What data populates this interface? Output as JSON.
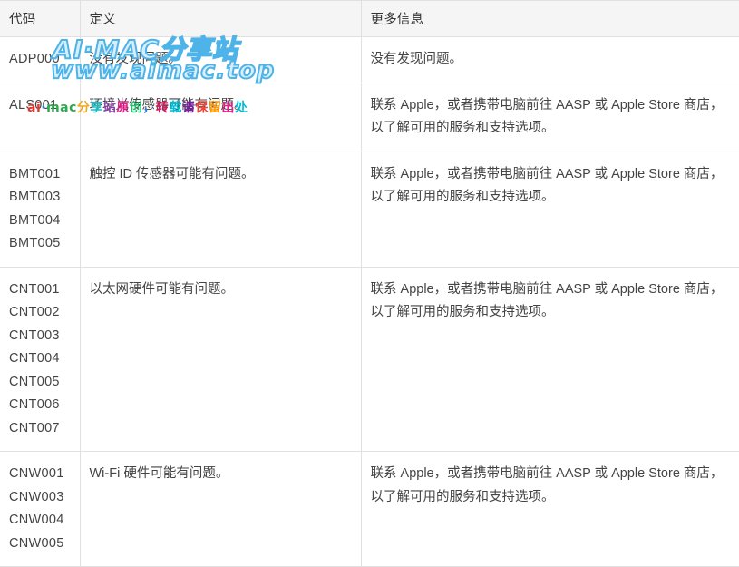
{
  "table": {
    "headers": [
      {
        "label": "代码"
      },
      {
        "label": "定义"
      },
      {
        "label": "更多信息"
      }
    ],
    "rows": [
      {
        "code": "ADP000",
        "definition": "没有发现问题。",
        "more_info": "没有发现问题。"
      },
      {
        "code": "ALS001",
        "definition": "环境光传感器可能有问题。",
        "more_info": "联系 Apple，或者携带电脑前往 AASP 或 Apple Store 商店，以了解可用的服务和支持选项。"
      },
      {
        "code": "BMT001\nBMT003\nBMT004\nBMT005",
        "definition": "触控 ID 传感器可能有问题。",
        "more_info": "联系 Apple，或者携带电脑前往 AASP 或 Apple Store 商店，以了解可用的服务和支持选项。"
      },
      {
        "code": "CNT001\nCNT002\nCNT003\nCNT004\nCNT005\nCNT006\nCNT007",
        "definition": "以太网硬件可能有问题。",
        "more_info": "联系 Apple，或者携带电脑前往 AASP 或 Apple Store 商店，以了解可用的服务和支持选项。"
      },
      {
        "code": "CNW001\nCNW003\nCNW004\nCNW005",
        "definition": "Wi-Fi 硬件可能有问题。",
        "more_info": "联系 Apple，或者携带电脑前往 AASP 或 Apple Store 商店，以了解可用的服务和支持选项。"
      }
    ]
  },
  "watermarks": {
    "brand_line1": "AI·MAC分享站",
    "brand_line2": "www.aimac.top",
    "notice_parts": [
      "ai",
      "·",
      "mac",
      "分",
      "享",
      "站",
      "原",
      "创",
      "，",
      "转",
      "载",
      "请",
      "保",
      "留",
      "出",
      "处"
    ],
    "brand_color": "#4db3e8"
  }
}
